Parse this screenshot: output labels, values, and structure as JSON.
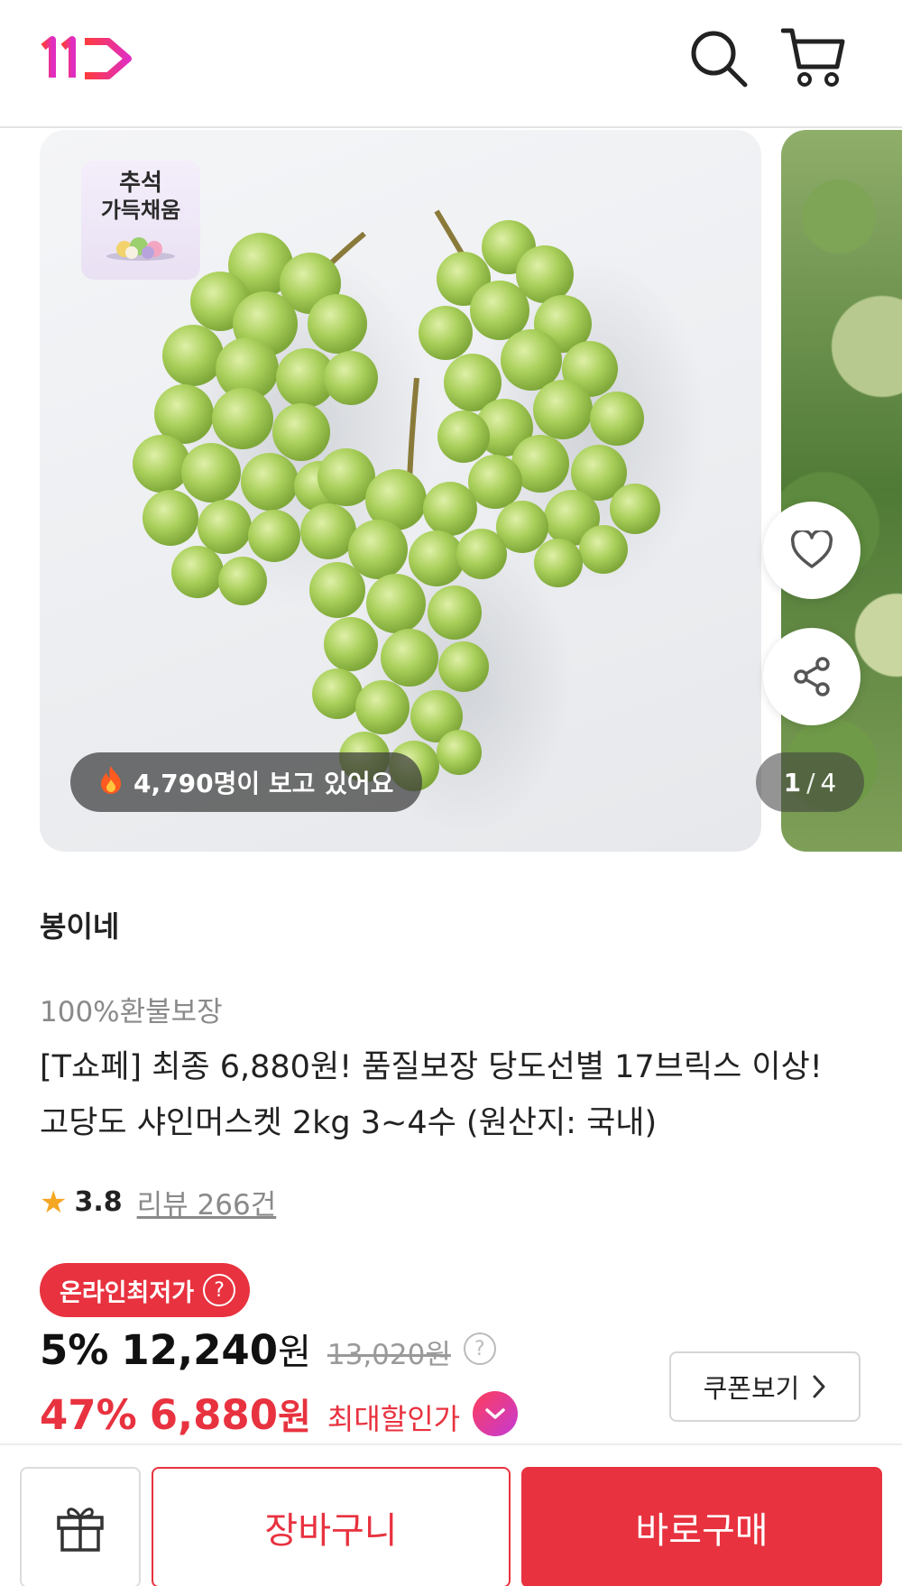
{
  "header": {
    "logo_icon": "11st-logo",
    "search_icon": "search-icon",
    "cart_icon": "cart-icon",
    "brand_color": "#e8323f"
  },
  "gallery": {
    "badge": {
      "line1": "추석",
      "line2": "가득채움"
    },
    "viewers_icon": "fire-icon",
    "viewers_text": "4,790명이 보고 있어요",
    "current_page": "1",
    "separator": "/",
    "total_pages": "4",
    "like_icon": "heart-icon",
    "share_icon": "share-icon"
  },
  "product": {
    "seller": "봉이네",
    "guarantee": "100%환불보장",
    "title": "[T쇼페] 최종 6,880원! 품질보장 당도선별 17브릭스 이상! 고당도 샤인머스켓 2kg 3~4수 (원산지: 국내)",
    "rating": "3.8",
    "review_text": "리뷰 266건",
    "rating_color": "#f5a623"
  },
  "pricing": {
    "lowest_badge": "온라인최저가",
    "help_symbol": "?",
    "discount1_rate": "5%",
    "discount1_price": "12,240",
    "won": "원",
    "original_price": "13,020원",
    "discount2_rate": "47%",
    "discount2_price": "6,880",
    "max_discount_label": "최대할인가",
    "coupon_label": "쿠폰보기",
    "sale_color": "#e8323f"
  },
  "bottom_bar": {
    "gift_icon": "gift-icon",
    "cart_label": "장바구니",
    "buy_label": "바로구매"
  }
}
